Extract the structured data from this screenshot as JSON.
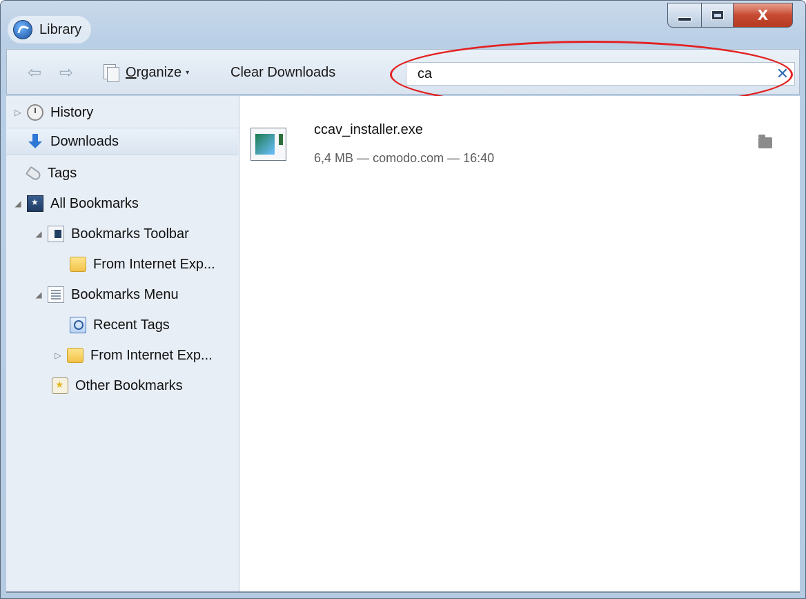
{
  "window": {
    "title": "Library",
    "controls": {
      "minimize_icon": "minimize-icon",
      "maximize_icon": "maximize-icon",
      "close_glyph": "X"
    }
  },
  "toolbar": {
    "back_icon": "back-arrow-icon",
    "forward_icon": "forward-arrow-icon",
    "organize": {
      "underlined": "O",
      "rest": "rganize",
      "caret": "▾"
    },
    "clear_downloads_label": "Clear Downloads",
    "search": {
      "value": "ca",
      "clear_glyph": "✕"
    }
  },
  "sidebar": {
    "items": [
      {
        "label": "History",
        "icon": "clock-icon",
        "twisty": "▷"
      },
      {
        "label": "Downloads",
        "icon": "download-arrow-icon",
        "selected": true
      },
      {
        "label": "Tags",
        "icon": "tag-icon"
      },
      {
        "label": "All Bookmarks",
        "icon": "bookmarks-library-icon",
        "twisty": "◢"
      },
      {
        "label": "Bookmarks Toolbar",
        "icon": "bookmarks-toolbar-icon",
        "twisty": "◢"
      },
      {
        "label": "From Internet Exp...",
        "icon": "folder-icon"
      },
      {
        "label": "Bookmarks Menu",
        "icon": "bookmarks-menu-icon",
        "twisty": "◢"
      },
      {
        "label": "Recent Tags",
        "icon": "recent-tags-icon"
      },
      {
        "label": "From Internet Exp...",
        "icon": "folder-icon",
        "twisty": "▷"
      },
      {
        "label": "Other Bookmarks",
        "icon": "other-bookmarks-icon"
      }
    ]
  },
  "downloads": [
    {
      "name": "ccav_installer.exe",
      "size": "6,4 MB",
      "source": "comodo.com",
      "time": "16:40",
      "separator": "—",
      "icon": "exe-file-icon",
      "action_icon": "open-folder-icon"
    }
  ],
  "colors": {
    "annotation": "#e32222",
    "accent": "#2d77d6",
    "clear_x": "#2e6db5"
  }
}
